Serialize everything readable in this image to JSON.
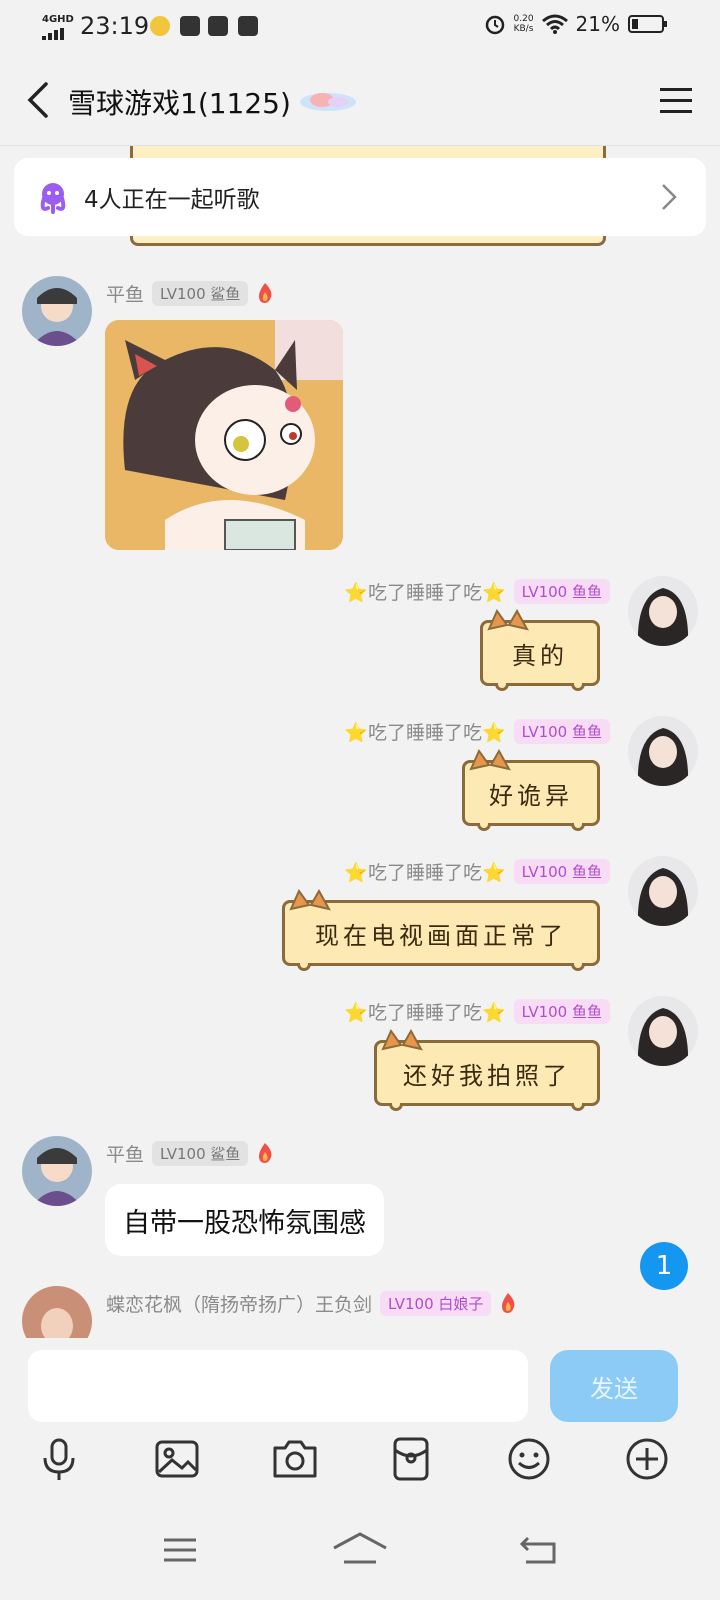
{
  "status_bar": {
    "network": "4GHD",
    "time": "23:19",
    "net_speed_value": "0.20",
    "net_speed_unit": "KB/s",
    "battery": "21%"
  },
  "header": {
    "title": "雪球游戏1(1125)"
  },
  "listen_banner": {
    "text": "4人正在一起听歌"
  },
  "messages": [
    {
      "name": "平鱼",
      "badge": "LV100 鲨鱼"
    },
    {
      "name": "⭐吃了睡睡了吃⭐",
      "badge": "LV100 鱼鱼",
      "text": "真的"
    },
    {
      "name": "⭐吃了睡睡了吃⭐",
      "badge": "LV100 鱼鱼",
      "text": "好诡异"
    },
    {
      "name": "⭐吃了睡睡了吃⭐",
      "badge": "LV100 鱼鱼",
      "text": "现在电视画面正常了"
    },
    {
      "name": "⭐吃了睡睡了吃⭐",
      "badge": "LV100 鱼鱼",
      "text": "还好我拍照了"
    },
    {
      "name": "平鱼",
      "badge": "LV100 鲨鱼",
      "text": "自带一股恐怖氛围感"
    },
    {
      "name": "蝶恋花枫（隋扬帝扬广）王负剑",
      "badge": "LV100 白娘子"
    }
  ],
  "unread_count": "1",
  "composer": {
    "send_label": "发送",
    "placeholder": ""
  },
  "toolbar_icons": [
    "microphone-icon",
    "image-icon",
    "camera-icon",
    "red-packet-icon",
    "emoji-icon",
    "plus-icon"
  ],
  "colors": {
    "accent": "#1596f0",
    "send_disabled": "#8ccbf6",
    "bubble_fill": "#fde9b3",
    "bubble_border": "#8b6a3c",
    "badge_pink": "#b04ccf"
  }
}
